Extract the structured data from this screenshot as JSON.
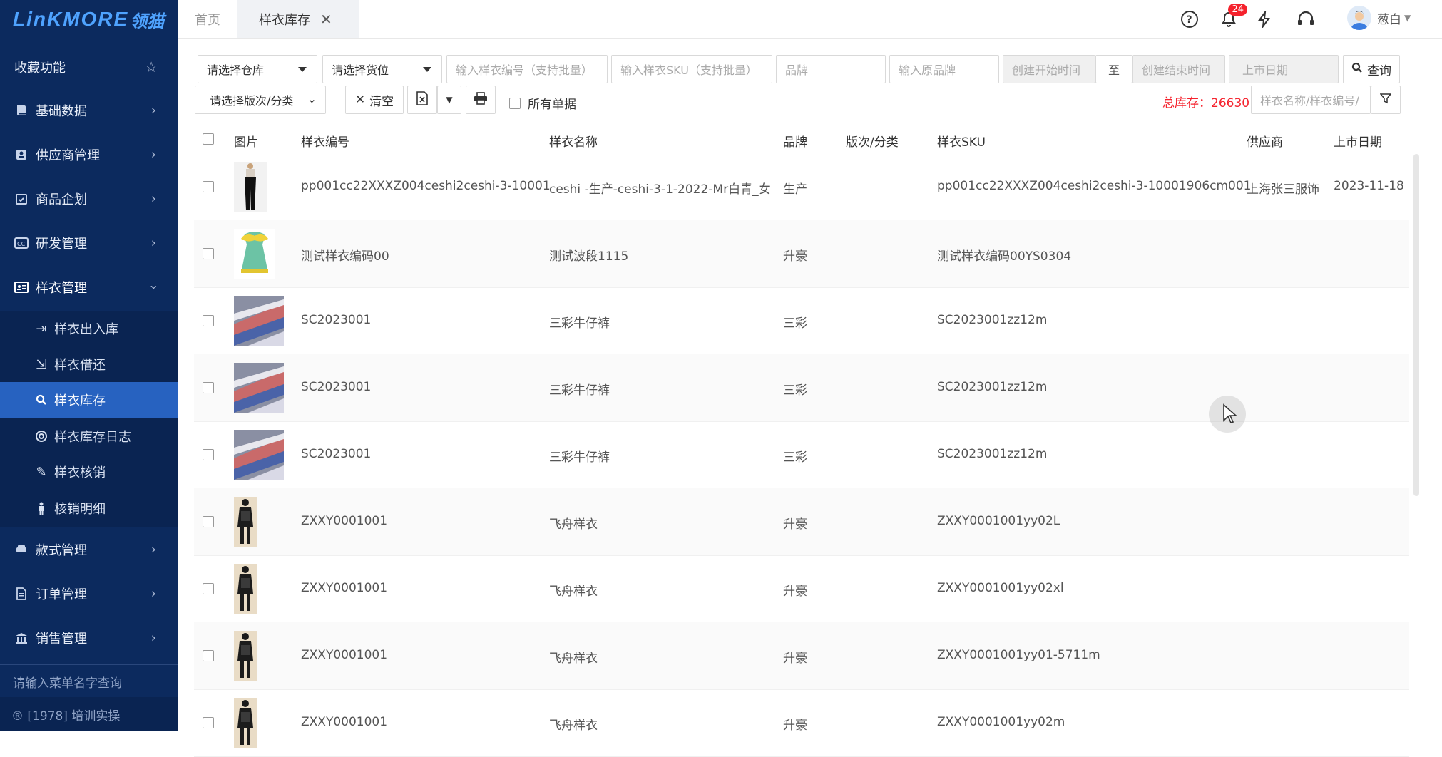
{
  "brand": {
    "logo_text": "LinKMORE",
    "logo_cn": "领猫"
  },
  "sidebar": {
    "favorites_label": "收藏功能",
    "items": [
      {
        "label": "基础数据",
        "icon": "book-icon"
      },
      {
        "label": "供应商管理",
        "icon": "supplier-icon"
      },
      {
        "label": "商品企划",
        "icon": "calendar-check-icon"
      },
      {
        "label": "研发管理",
        "icon": "cc-icon"
      },
      {
        "label": "样衣管理",
        "icon": "id-card-icon"
      },
      {
        "label": "款式管理",
        "icon": "car-icon"
      },
      {
        "label": "订单管理",
        "icon": "document-icon"
      },
      {
        "label": "销售管理",
        "icon": "bank-icon"
      }
    ],
    "sub_items": [
      {
        "label": "样衣出入库",
        "icon": "sign-in-icon"
      },
      {
        "label": "样衣借还",
        "icon": "share-icon"
      },
      {
        "label": "样衣库存",
        "icon": "search-icon"
      },
      {
        "label": "样衣库存日志",
        "icon": "lifebuoy-icon"
      },
      {
        "label": "样衣核销",
        "icon": "eyedropper-icon"
      },
      {
        "label": "核销明细",
        "icon": "person-icon"
      }
    ],
    "menu_search_placeholder": "请输入菜单名字查询",
    "footer": "® [1978] 培训实操"
  },
  "topbar": {
    "tabs": [
      {
        "label": "首页"
      },
      {
        "label": "样衣库存"
      }
    ],
    "notification_count": "24",
    "username": "葱白"
  },
  "filters": {
    "warehouse": "请选择仓库",
    "location": "请选择货位",
    "sample_no_placeholder": "输入样衣编号（支持批量）",
    "sku_placeholder": "输入样衣SKU（支持批量）",
    "brand_placeholder": "品牌",
    "orig_brand_placeholder": "输入原品牌",
    "create_start_placeholder": "创建开始时间",
    "to_label": "至",
    "create_end_placeholder": "创建结束时间",
    "launch_date_placeholder": "上市日期",
    "query_label": "查询",
    "version_select": "请选择版次/分类",
    "clear_label": "清空",
    "all_docs_label": "所有单据",
    "total_label": "总库存：26630",
    "search_placeholder": "样衣名称/样衣编号/"
  },
  "table": {
    "headers": [
      "图片",
      "样衣编号",
      "样衣名称",
      "品牌",
      "版次/分类",
      "样衣SKU",
      "供应商",
      "上市日期"
    ],
    "rows": [
      {
        "img": "black-pants",
        "code": "pp001cc22XXXZ004ceshi2ceshi-3-10001",
        "name": "ceshi -生产-ceshi-3-1-2022-Mr白青_女",
        "brand": "生产",
        "version": "",
        "sku": "pp001cc22XXXZ004ceshi2ceshi-3-10001906cm001",
        "supplier": "上海张三服饰",
        "date": "2023-11-18"
      },
      {
        "img": "green-dress",
        "code": "测试样衣编码00",
        "name": "测试波段1115",
        "brand": "升豪",
        "version": "",
        "sku": "测试样衣编码00YS0304",
        "supplier": "",
        "date": ""
      },
      {
        "img": "fabric",
        "code": "SC2023001",
        "name": "三彩牛仔裤",
        "brand": "三彩",
        "version": "",
        "sku": "SC2023001zz12m",
        "supplier": "",
        "date": ""
      },
      {
        "img": "fabric",
        "code": "SC2023001",
        "name": "三彩牛仔裤",
        "brand": "三彩",
        "version": "",
        "sku": "SC2023001zz12m",
        "supplier": "",
        "date": ""
      },
      {
        "img": "fabric",
        "code": "SC2023001",
        "name": "三彩牛仔裤",
        "brand": "三彩",
        "version": "",
        "sku": "SC2023001zz12m",
        "supplier": "",
        "date": ""
      },
      {
        "img": "model",
        "code": "ZXXY0001001",
        "name": "飞舟样衣",
        "brand": "升豪",
        "version": "",
        "sku": "ZXXY0001001yy02L",
        "supplier": "",
        "date": ""
      },
      {
        "img": "model",
        "code": "ZXXY0001001",
        "name": "飞舟样衣",
        "brand": "升豪",
        "version": "",
        "sku": "ZXXY0001001yy02xl",
        "supplier": "",
        "date": ""
      },
      {
        "img": "model",
        "code": "ZXXY0001001",
        "name": "飞舟样衣",
        "brand": "升豪",
        "version": "",
        "sku": "ZXXY0001001yy01-5711m",
        "supplier": "",
        "date": ""
      },
      {
        "img": "model",
        "code": "ZXXY0001001",
        "name": "飞舟样衣",
        "brand": "升豪",
        "version": "",
        "sku": "ZXXY0001001yy02m",
        "supplier": "",
        "date": ""
      }
    ]
  }
}
